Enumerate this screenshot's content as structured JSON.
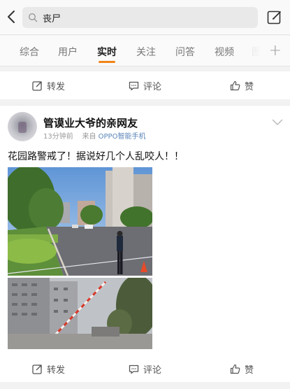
{
  "search": {
    "query": "丧尸"
  },
  "tabs": [
    {
      "label": "综合"
    },
    {
      "label": "用户"
    },
    {
      "label": "实时"
    },
    {
      "label": "关注"
    },
    {
      "label": "问答"
    },
    {
      "label": "视频"
    }
  ],
  "actions": {
    "repost": "转发",
    "comment": "评论",
    "like": "赞"
  },
  "post": {
    "username": "管谟业大爷的亲网友",
    "time": "13分钟前",
    "from_label": "来自",
    "source": "OPPO智能手机",
    "text": "花园路警戒了！据说好几个人乱咬人！！"
  },
  "colors": {
    "accent": "#f08519",
    "link": "#5b86b9"
  }
}
